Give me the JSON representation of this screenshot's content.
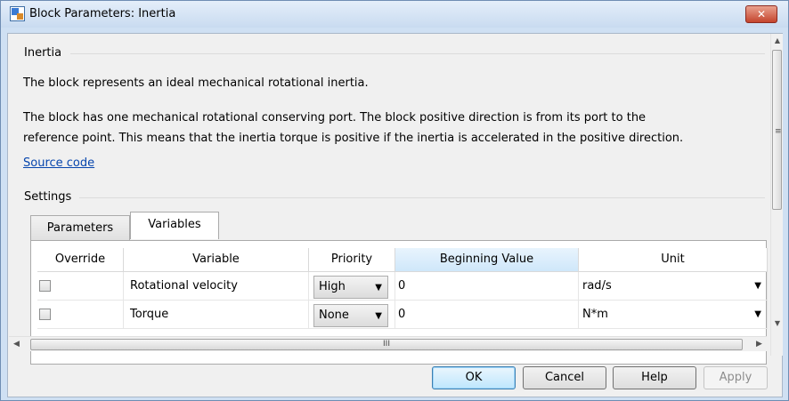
{
  "window": {
    "title": "Block Parameters: Inertia",
    "close_glyph": "✕"
  },
  "block": {
    "group_title": "Inertia",
    "description_1": "The block represents an ideal mechanical rotational inertia.",
    "description_2a": "The block has one mechanical rotational conserving port. The block positive direction is from its port to the",
    "description_2b": "reference point. This means that the inertia torque is positive if the inertia is accelerated in the positive direction.",
    "source_link": "Source code"
  },
  "settings": {
    "group_title": "Settings",
    "tabs": [
      {
        "label": "Parameters",
        "active": false
      },
      {
        "label": "Variables",
        "active": true
      }
    ]
  },
  "table": {
    "columns": [
      "Override",
      "Variable",
      "Priority",
      "Beginning Value",
      "Unit"
    ],
    "highlighted_column": "Beginning Value",
    "rows": [
      {
        "override": false,
        "variable": "Rotational velocity",
        "priority": "High",
        "beginning_value": "0",
        "unit": "rad/s"
      },
      {
        "override": false,
        "variable": "Torque",
        "priority": "None",
        "beginning_value": "0",
        "unit": "N*m"
      }
    ]
  },
  "scrollbar": {
    "grip": "III",
    "vgrip": "≡",
    "left": "◀",
    "right": "▶",
    "up": "▲",
    "down": "▼"
  },
  "dropdown_caret": "▼",
  "buttons": {
    "ok": "OK",
    "cancel": "Cancel",
    "help": "Help",
    "apply": "Apply"
  }
}
